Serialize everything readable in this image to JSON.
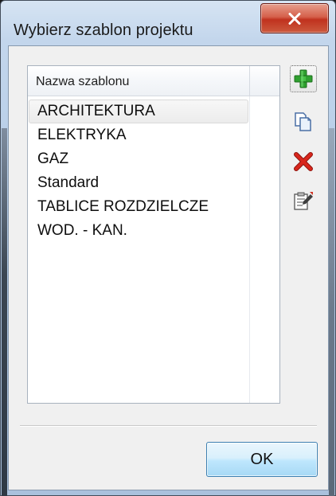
{
  "window": {
    "title": "Wybierz szablon projektu",
    "close_icon": "close-icon"
  },
  "list": {
    "column_header": "Nazwa szablonu",
    "items": [
      {
        "label": "ARCHITEKTURA",
        "selected": true
      },
      {
        "label": "ELEKTRYKA",
        "selected": false
      },
      {
        "label": "GAZ",
        "selected": false
      },
      {
        "label": "Standard",
        "selected": false
      },
      {
        "label": "TABLICE ROZDZIELCZE",
        "selected": false
      },
      {
        "label": "WOD. - KAN.",
        "selected": false
      }
    ]
  },
  "toolbar": {
    "buttons": [
      {
        "icon": "add-plus-icon"
      },
      {
        "icon": "copy-icon"
      },
      {
        "icon": "delete-x-icon"
      },
      {
        "icon": "properties-icon"
      }
    ]
  },
  "footer": {
    "ok_label": "OK"
  },
  "colors": {
    "title_bar": "#b9cfe8",
    "close_button": "#c0321e",
    "client_bg": "#f0f0f0",
    "ok_button": "#bee6fd",
    "add_green": "#2fa02f",
    "delete_red": "#d8261c"
  }
}
